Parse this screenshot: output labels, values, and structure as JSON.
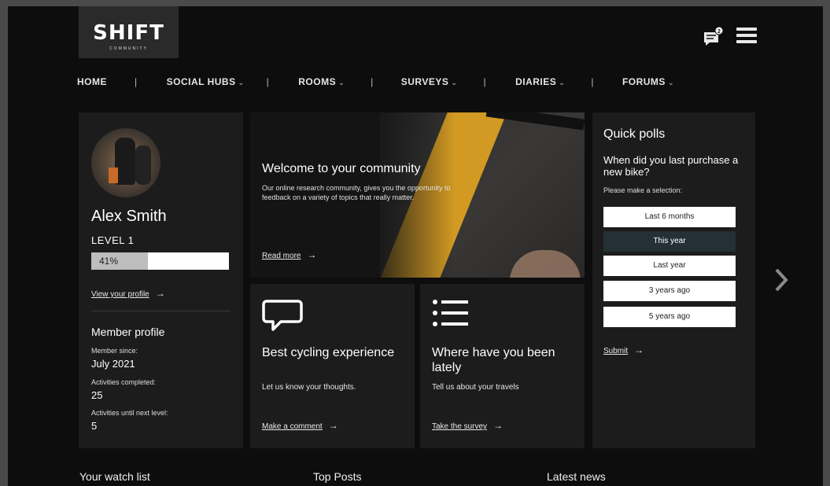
{
  "brand": {
    "name": "SHIFT",
    "tagline": "COMMUNITY"
  },
  "header": {
    "notification_count": "2",
    "chat_icon": "chat-icon",
    "menu_icon": "hamburger-menu-icon"
  },
  "nav": [
    {
      "label": "HOME",
      "dropdown": false
    },
    {
      "label": "SOCIAL HUBS",
      "dropdown": true
    },
    {
      "label": "ROOMS",
      "dropdown": true
    },
    {
      "label": "SURVEYS",
      "dropdown": true
    },
    {
      "label": "DIARIES",
      "dropdown": true
    },
    {
      "label": "FORUMS",
      "dropdown": true
    }
  ],
  "nav_separator": "|",
  "profile": {
    "name": "Alex Smith",
    "level": "LEVEL 1",
    "progress_label": "41%",
    "progress_value": 0.41,
    "view_link": "View your profile",
    "member_title": "Member profile",
    "stats": [
      {
        "label": "Member since:",
        "value": "July 2021"
      },
      {
        "label": "Activities completed:",
        "value": "25"
      },
      {
        "label": "Activities until next level:",
        "value": "5"
      }
    ]
  },
  "hero": {
    "title": "Welcome to your community",
    "description": "Our online research community, gives you the opportunity to feedback on a variety of topics that really matter.",
    "link": "Read more"
  },
  "tiles": [
    {
      "title": "Best cycling experience",
      "text": "Let us know your thoughts.",
      "link": "Make a comment",
      "icon": "speech-bubble-icon"
    },
    {
      "title": "Where have you been lately",
      "text": "Tell us about your travels",
      "link": "Take the survey",
      "icon": "list-icon"
    }
  ],
  "polls": {
    "title": "Quick polls",
    "question": "When did you last purchase a new bike?",
    "instruction": "Please make a selection:",
    "options": [
      "Last 6 months",
      "This year",
      "Last year",
      "3 years ago",
      "5 years ago"
    ],
    "selected": "This year",
    "submit": "Submit"
  },
  "arrow_glyph": "→",
  "bottom_sections": [
    "Your watch list",
    "Top Posts",
    "Latest news"
  ],
  "colors": {
    "background": "#0d0d0d",
    "card": "#1c1c1c",
    "accent_selected": "#243035",
    "hero_stripe": "#d29a22"
  }
}
